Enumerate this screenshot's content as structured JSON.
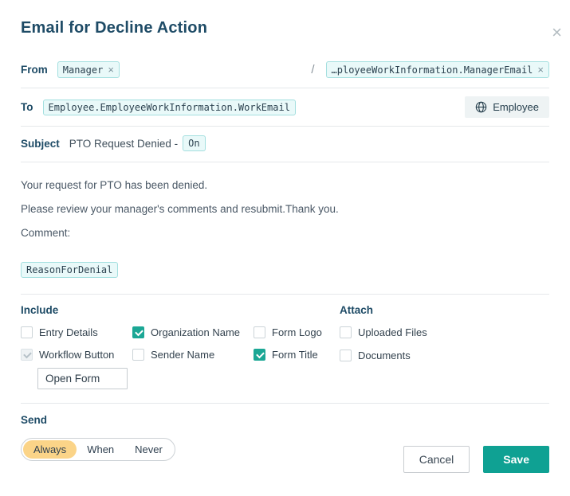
{
  "dialog": {
    "title": "Email for Decline Action",
    "close_icon": "×"
  },
  "from": {
    "label": "From",
    "tag1": "Manager",
    "separator": "/",
    "tag2": "…ployeeWorkInformation.ManagerEmail",
    "remove_icon": "×"
  },
  "to": {
    "label": "To",
    "tag": "Employee.EmployeeWorkInformation.WorkEmail",
    "button_label": "Employee"
  },
  "subject": {
    "label": "Subject",
    "text": "PTO Request Denied -",
    "tag": "On"
  },
  "body": {
    "line1": "Your request for PTO has been denied.",
    "line2": "Please review your manager's comments and resubmit.Thank you.",
    "line3": "Comment:",
    "tag": "ReasonForDenial"
  },
  "include": {
    "label": "Include",
    "options": [
      {
        "label": "Entry Details",
        "checked": false,
        "disabled": false
      },
      {
        "label": "Organization Name",
        "checked": true,
        "disabled": false
      },
      {
        "label": "Form Logo",
        "checked": false,
        "disabled": false
      },
      {
        "label": "Workflow Button",
        "checked": true,
        "disabled": true
      },
      {
        "label": "Sender Name",
        "checked": false,
        "disabled": false
      },
      {
        "label": "Form Title",
        "checked": true,
        "disabled": false
      }
    ],
    "workflow_button_text": "Open Form"
  },
  "attach": {
    "label": "Attach",
    "options": [
      {
        "label": "Uploaded Files",
        "checked": false
      },
      {
        "label": "Documents",
        "checked": false
      }
    ]
  },
  "send": {
    "label": "Send",
    "options": [
      "Always",
      "When",
      "Never"
    ],
    "selected": "Always"
  },
  "footer": {
    "cancel_label": "Cancel",
    "save_label": "Save"
  },
  "colors": {
    "accent_teal": "#0fa193",
    "checkbox_teal": "#1ba795",
    "tag_background": "#e9f9f9",
    "tag_border": "#a3dfdf",
    "selected_segment": "#fbd488",
    "heading_text": "#1e4b66"
  }
}
